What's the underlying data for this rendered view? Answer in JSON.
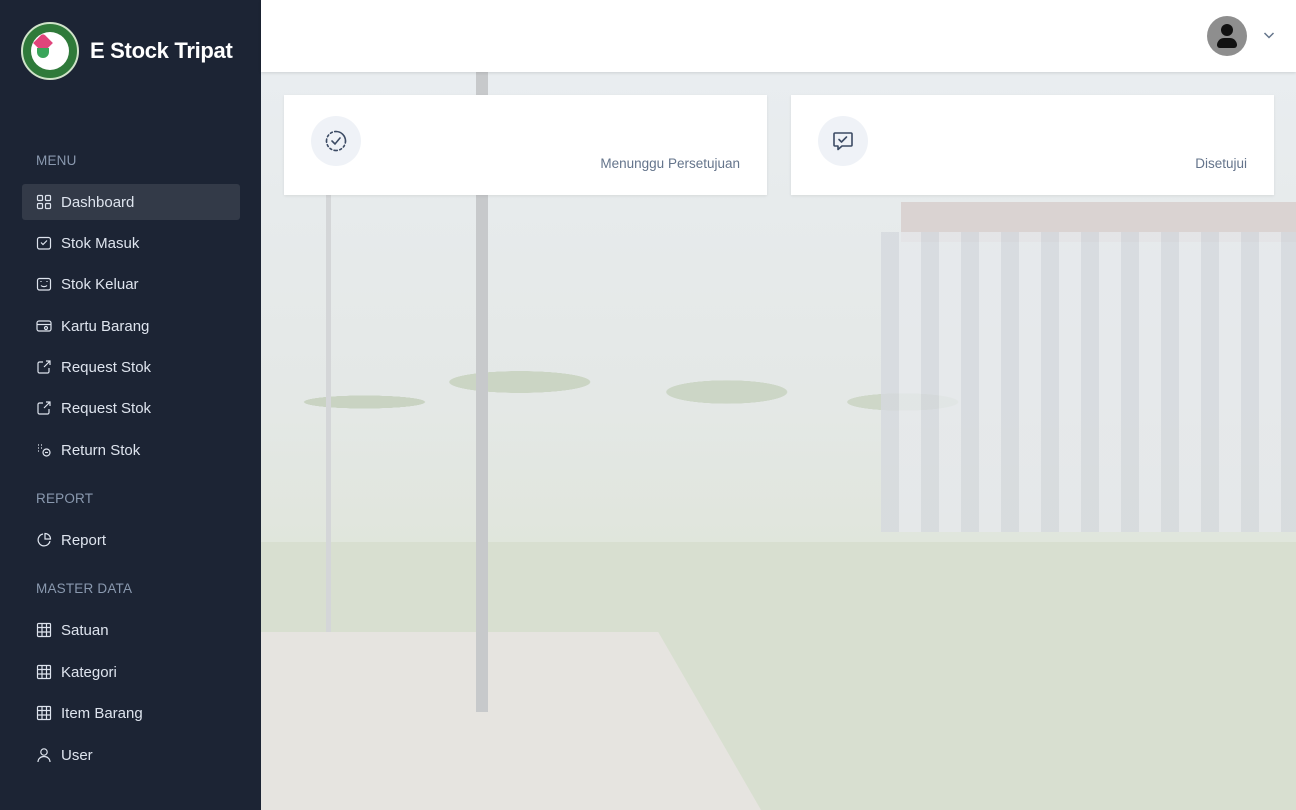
{
  "app": {
    "title": "E Stock Tripat"
  },
  "sidebar": {
    "sections": {
      "menu": "MENU",
      "report": "REPORT",
      "master_data": "MASTER DATA"
    },
    "items": [
      {
        "label": "Dashboard",
        "icon": "grid-icon",
        "active": true
      },
      {
        "label": "Stok Masuk",
        "icon": "box-in-icon"
      },
      {
        "label": "Stok Keluar",
        "icon": "box-out-icon"
      },
      {
        "label": "Kartu Barang",
        "icon": "card-icon"
      },
      {
        "label": "Request Stok",
        "icon": "external-link-icon"
      },
      {
        "label": "Request Stok",
        "icon": "external-link-icon"
      },
      {
        "label": "Return Stok",
        "icon": "return-icon"
      },
      {
        "label": "Report",
        "icon": "pie-chart-icon"
      },
      {
        "label": "Satuan",
        "icon": "table-icon"
      },
      {
        "label": "Kategori",
        "icon": "table-icon"
      },
      {
        "label": "Item Barang",
        "icon": "table-icon"
      },
      {
        "label": "User",
        "icon": "user-icon"
      }
    ]
  },
  "header": {
    "avatar_icon": "user-avatar-icon",
    "menu_icon": "chevron-down-icon"
  },
  "cards": [
    {
      "label": "Menunggu Persetujuan",
      "icon": "pending-check-icon"
    },
    {
      "label": "Disetujui",
      "icon": "approved-message-icon"
    }
  ],
  "colors": {
    "sidebar_bg": "#1c2434",
    "active_item_bg": "#333a48",
    "header_bg": "#ffffff"
  }
}
